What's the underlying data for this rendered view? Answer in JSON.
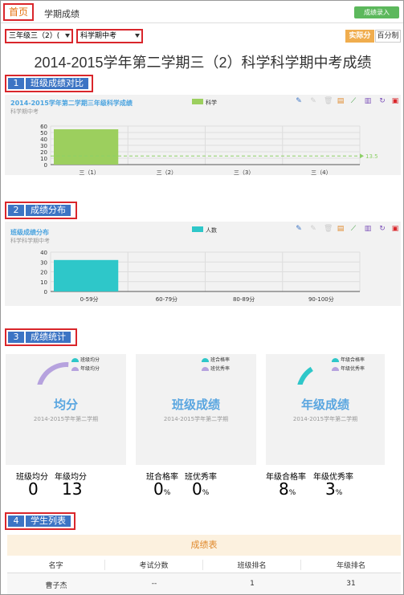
{
  "tabs": {
    "home": "首页",
    "scores": "学期成绩"
  },
  "enter_button": "成绩录入",
  "filters": {
    "class": "三年级三（2）(",
    "exam": "科学期中考"
  },
  "score_toggle": {
    "actual": "实际分",
    "percent": "百分制"
  },
  "page_title": "2014-2015学年第二学期三（2）科学科学期中考成绩",
  "sections": [
    {
      "num": "1",
      "label": "班级成绩对比"
    },
    {
      "num": "2",
      "label": "成绩分布"
    },
    {
      "num": "3",
      "label": "成绩统计"
    },
    {
      "num": "4",
      "label": "学生列表"
    }
  ],
  "toolbar_icons": [
    "pencil-icon",
    "eraser-icon",
    "trash-icon",
    "document-icon",
    "line-chart-icon",
    "bar-chart-icon",
    "refresh-icon",
    "save-icon"
  ],
  "chart_data": [
    {
      "type": "bar",
      "title": "2014-2015学年第二学期三年级科学成绩",
      "subtitle": "科学期中考",
      "legend": [
        "科学"
      ],
      "categories": [
        "三（1）",
        "三（2）",
        "三（3）",
        "三（4）"
      ],
      "series": [
        {
          "name": "科学",
          "values": [
            55,
            0,
            0,
            0
          ]
        }
      ],
      "average_line": 13.5,
      "average_label": "13.5",
      "yticks": [
        "60",
        "50",
        "40",
        "30",
        "20",
        "10",
        "0"
      ],
      "ylim": [
        0,
        60
      ],
      "colors": {
        "bar": "#9ccf5e",
        "avg": "#8dd067"
      }
    },
    {
      "type": "bar",
      "title": "班级成绩分布",
      "subtitle": "科学科学期中考",
      "legend": [
        "人数"
      ],
      "categories": [
        "0-59分",
        "60-79分",
        "80-89分",
        "90-100分"
      ],
      "series": [
        {
          "name": "人数",
          "values": [
            32,
            0,
            0,
            0
          ]
        }
      ],
      "yticks": [
        "40",
        "30",
        "20",
        "10",
        "0"
      ],
      "ylim": [
        0,
        40
      ],
      "colors": {
        "bar": "#2ec7c9"
      }
    }
  ],
  "stat_cards": [
    {
      "legend": [
        "班级均分",
        "年级均分"
      ],
      "title": "均分",
      "sub": "2014-2015学年第二学期"
    },
    {
      "legend": [
        "班合格率",
        "班优秀率"
      ],
      "title": "班级成绩",
      "sub": "2014-2015学年第二学期"
    },
    {
      "legend": [
        "年级合格率",
        "年级优秀率"
      ],
      "title": "年级成绩",
      "sub": "2014-2015学年第二学期"
    }
  ],
  "stats": [
    {
      "labels": [
        "班级均分",
        "年级均分"
      ],
      "values": [
        "0",
        "13"
      ],
      "units": [
        "",
        ""
      ]
    },
    {
      "labels": [
        "班合格率",
        "班优秀率"
      ],
      "values": [
        "0",
        "0"
      ],
      "units": [
        "%",
        "%"
      ]
    },
    {
      "labels": [
        "年级合格率",
        "年级优秀率"
      ],
      "values": [
        "8",
        "3"
      ],
      "units": [
        "%",
        "%"
      ]
    }
  ],
  "gauges": [
    {
      "primary": 0,
      "secondary": 13
    },
    {
      "primary": 0,
      "secondary": 0
    },
    {
      "primary": 8,
      "secondary": 3
    }
  ],
  "table": {
    "caption": "成绩表",
    "headers": [
      "名字",
      "考试分数",
      "班级排名",
      "年级排名"
    ],
    "rows": [
      [
        "曹子杰",
        "--",
        "1",
        "31"
      ]
    ]
  },
  "colors": {
    "accent": "#3c74c4",
    "highlight": "#d9262b",
    "teal": "#2ec7c9",
    "lavender": "#b6a2de",
    "green": "#5cb85c",
    "orange": "#f0ad4e"
  }
}
